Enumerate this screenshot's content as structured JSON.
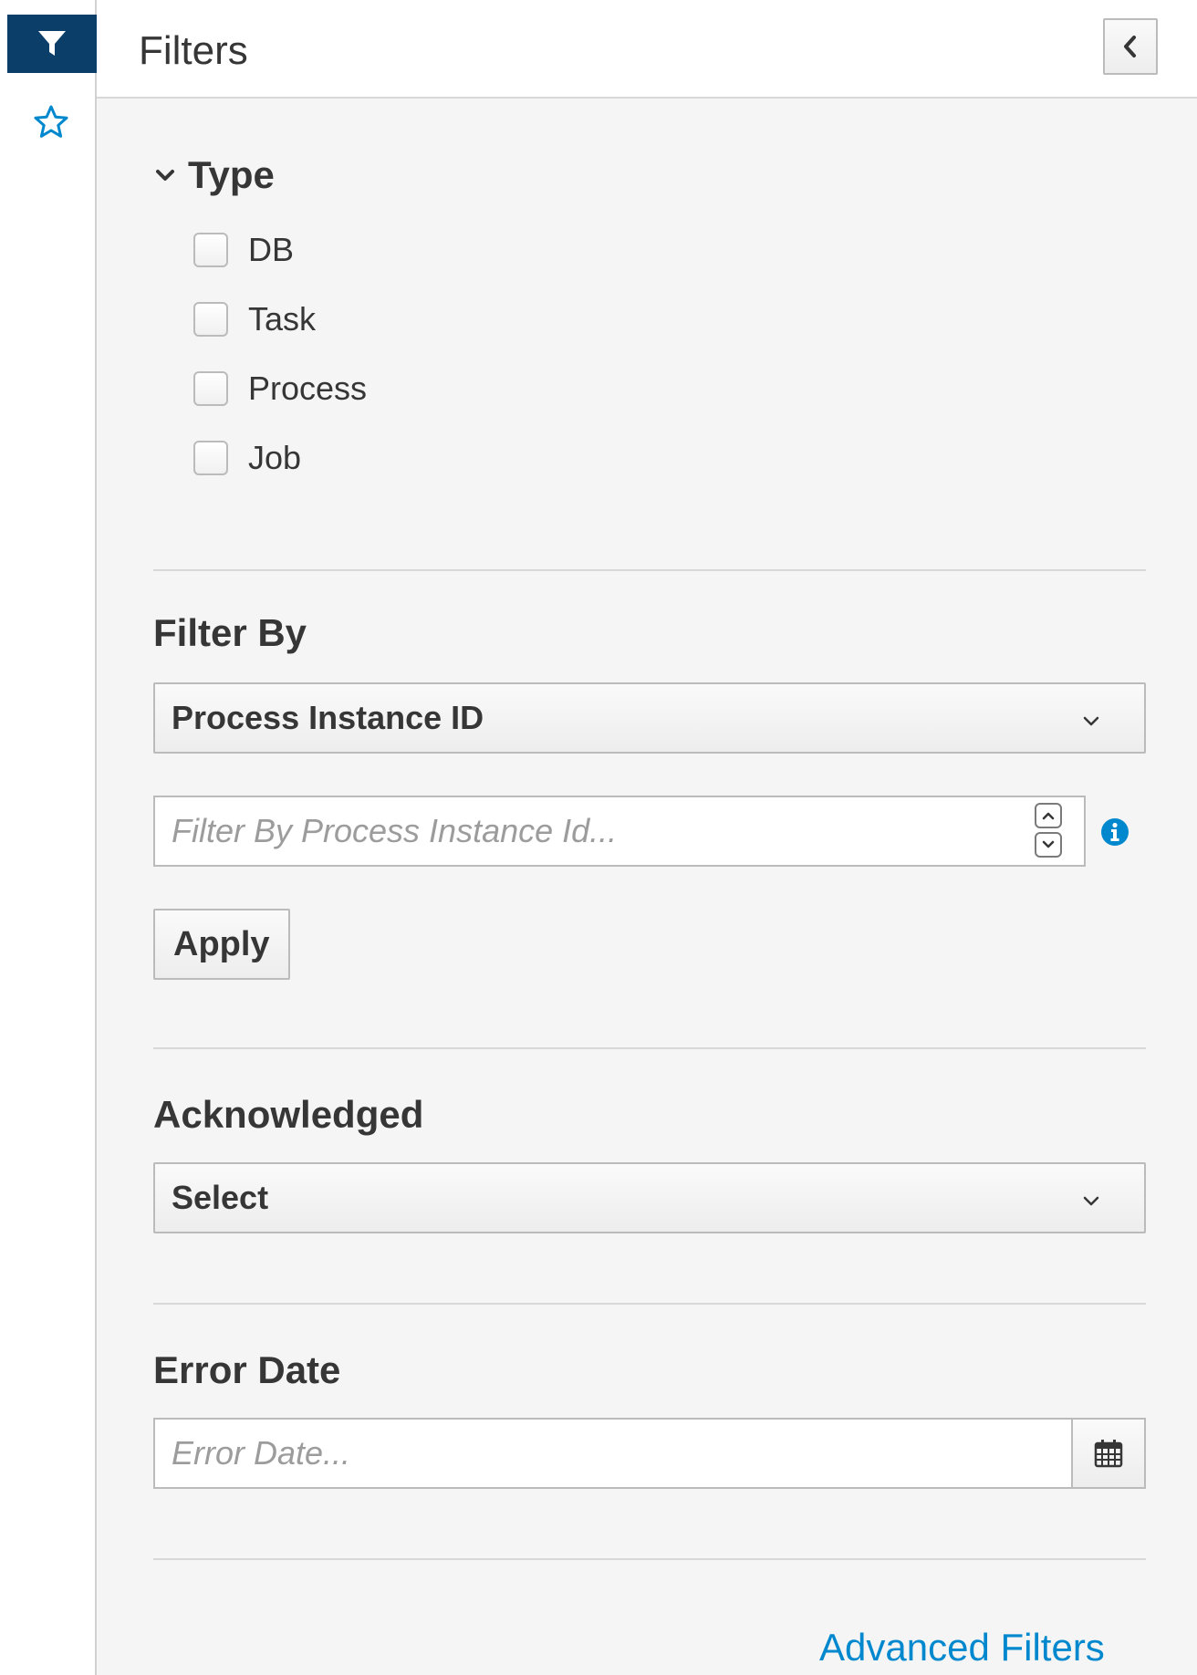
{
  "header": {
    "title": "Filters",
    "collapse_icon": "chevron-left-icon"
  },
  "rail": {
    "filter_icon": "filter-icon",
    "star_icon": "star-icon",
    "accent_color": "#0b3e68",
    "star_color": "#0088ce"
  },
  "type_section": {
    "title": "Type",
    "options": [
      {
        "label": "DB",
        "checked": false
      },
      {
        "label": "Task",
        "checked": false
      },
      {
        "label": "Process",
        "checked": false
      },
      {
        "label": "Job",
        "checked": false
      }
    ]
  },
  "filter_by": {
    "title": "Filter By",
    "selected": "Process Instance ID",
    "input_placeholder": "Filter By Process Instance Id...",
    "apply_label": "Apply"
  },
  "acknowledged": {
    "title": "Acknowledged",
    "selected": "Select"
  },
  "error_date": {
    "title": "Error Date",
    "placeholder": "Error Date..."
  },
  "advanced_link": "Advanced Filters"
}
